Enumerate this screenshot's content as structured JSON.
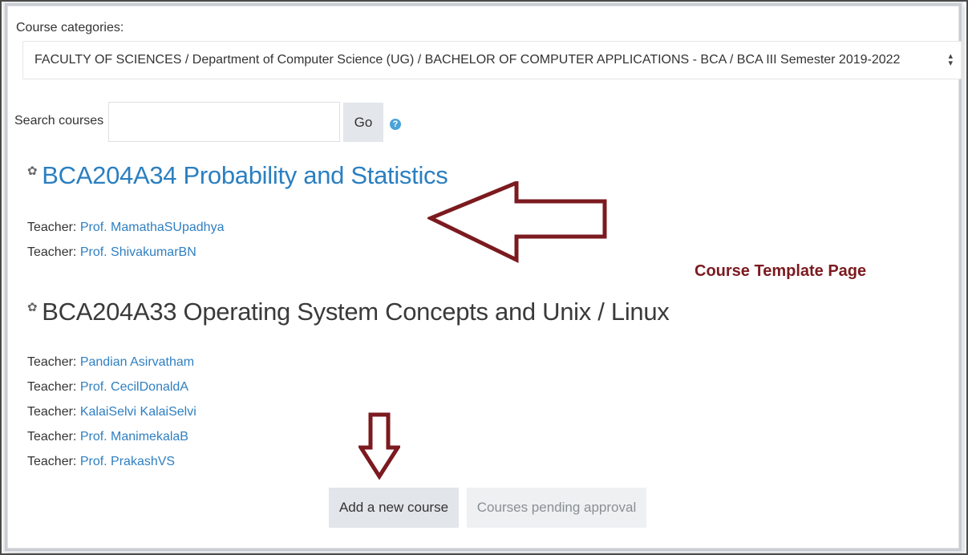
{
  "categories": {
    "label": "Course categories:",
    "selected": "FACULTY OF SCIENCES / Department of Computer Science (UG) / BACHELOR OF COMPUTER APPLICATIONS - BCA / BCA III Semester 2019-2022"
  },
  "search": {
    "label": "Search courses",
    "value": "",
    "go_label": "Go",
    "help_icon": "question-circle-icon"
  },
  "courses": [
    {
      "title": "BCA204A34 Probability and Statistics",
      "icon": "course-icon",
      "teachers": [
        {
          "prefix": "Teacher: ",
          "name": "Prof. MamathaSUpadhya"
        },
        {
          "prefix": "Teacher: ",
          "name": "Prof. ShivakumarBN"
        }
      ]
    },
    {
      "title": "BCA204A33 Operating System Concepts and Unix / Linux",
      "icon": "course-icon",
      "teachers": [
        {
          "prefix": "Teacher: ",
          "name": "Pandian Asirvatham"
        },
        {
          "prefix": "Teacher: ",
          "name": "Prof. CecilDonaldA"
        },
        {
          "prefix": "Teacher: ",
          "name": "KalaiSelvi KalaiSelvi"
        },
        {
          "prefix": "Teacher: ",
          "name": "Prof. ManimekalaB"
        },
        {
          "prefix": "Teacher: ",
          "name": "Prof. PrakashVS"
        }
      ]
    }
  ],
  "annotation": {
    "label": "Course Template Page",
    "color": "#7b1a1f"
  },
  "actions": {
    "add_label": "Add a new course",
    "pending_label": "Courses pending approval"
  }
}
